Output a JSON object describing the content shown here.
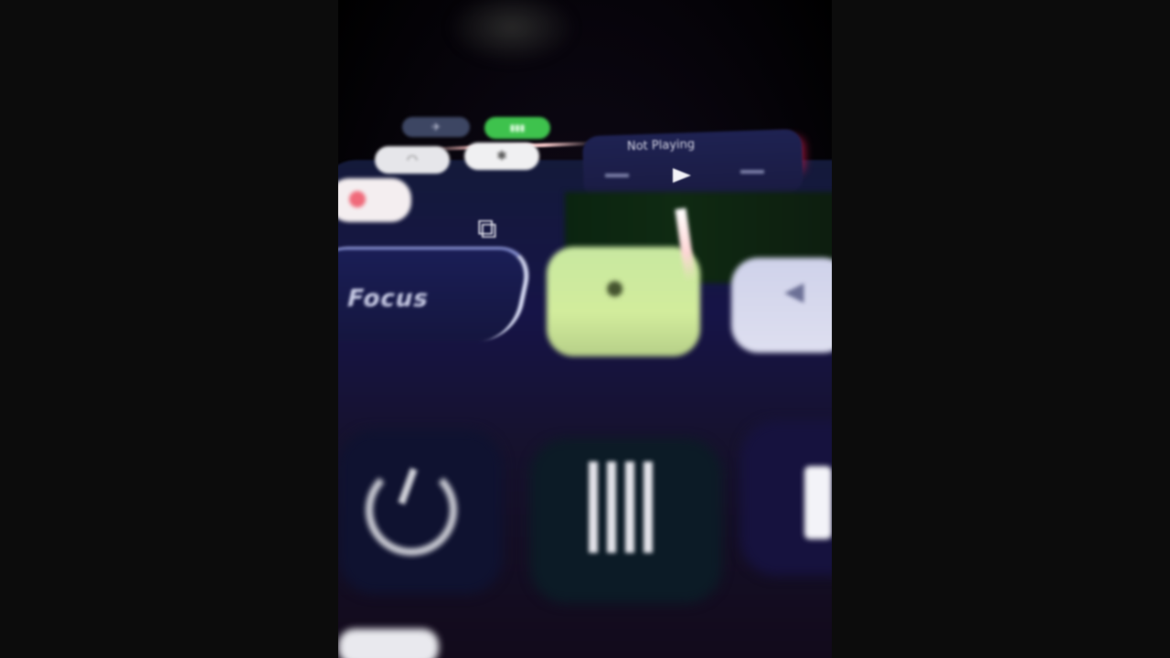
{
  "control_center": {
    "connectivity": {
      "airplane_icon": "airplane-icon",
      "cellular_icon": "cellular-icon",
      "wifi_icon": "wifi-icon",
      "bluetooth_icon": "bluetooth-icon"
    },
    "now_playing": {
      "title": "Not Playing"
    },
    "focus": {
      "label": "Focus"
    },
    "colors": {
      "cellular_active": "#3ec24d",
      "brightness_slider": "#cfe99c",
      "volume_slider": "#d7d9ee",
      "panel_background": "#161447",
      "record_dot": "#f06a7a"
    }
  }
}
